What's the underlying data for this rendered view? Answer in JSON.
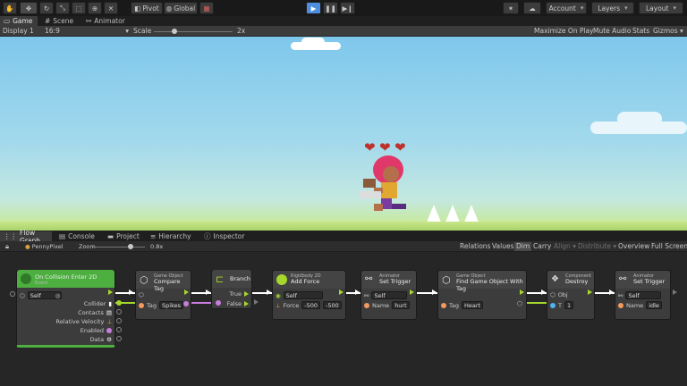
{
  "toolbar": {
    "pivot": "Pivot",
    "global": "Global",
    "account": "Account",
    "layers": "Layers",
    "layout": "Layout"
  },
  "tabs": [
    {
      "label": "Game"
    },
    {
      "label": "Scene"
    },
    {
      "label": "Animator"
    }
  ],
  "gamebar": {
    "display": "Display 1",
    "aspect": "16:9",
    "scale_label": "Scale",
    "scale_value": "2x",
    "maximize": "Maximize On Play",
    "mute": "Mute Audio",
    "stats": "Stats",
    "gizmos": "Gizmos"
  },
  "scene": {
    "hearts": [
      "❤",
      "❤",
      "❤"
    ]
  },
  "bottom_tabs": [
    {
      "label": "Flow Graph"
    },
    {
      "label": "Console"
    },
    {
      "label": "Project"
    },
    {
      "label": "Hierarchy"
    },
    {
      "label": "Inspector"
    }
  ],
  "graph_toolbar": {
    "object": "PennyPixel",
    "zoom_label": "Zoom",
    "zoom_value": "0.8x",
    "relations": "Relations",
    "values": "Values",
    "dim": "Dim",
    "carry": "Carry",
    "align": "Align",
    "distribute": "Distribute",
    "overview": "Overview",
    "fullscreen": "Full Screen"
  },
  "nodes": {
    "event": {
      "title": "On Collision Enter 2D",
      "category": "Event",
      "self": "Self",
      "outputs": [
        "Collider",
        "Contacts",
        "Relative Velocity",
        "Enabled",
        "Data"
      ]
    },
    "compare": {
      "category": "Game Object",
      "title": "Compare Tag",
      "tag_label": "Tag",
      "tag_value": "Spikes"
    },
    "branch": {
      "title": "Branch",
      "true_label": "True",
      "false_label": "False"
    },
    "addforce": {
      "category": "Rigidbody 2D",
      "title": "Add Force",
      "self": "Self",
      "force_label": "Force",
      "fx": "-500",
      "fy": "-500"
    },
    "trigger1": {
      "category": "Animator",
      "title": "Set Trigger",
      "self": "Self",
      "name_label": "Name",
      "name_value": "hurt"
    },
    "find": {
      "category": "Game Object",
      "title": "Find Game Object With Tag",
      "tag_label": "Tag",
      "tag_value": "Heart"
    },
    "destroy": {
      "category": "Component",
      "title": "Destroy",
      "obj_label": "Obj",
      "t_label": "T",
      "t_value": "1"
    },
    "trigger2": {
      "category": "Animator",
      "title": "Set Trigger",
      "self": "Self",
      "name_label": "Name",
      "name_value": "idle"
    }
  },
  "colors": {
    "accent": "#4d8ee0",
    "flow_green": "#a6d72c",
    "event_green": "#4caf3f",
    "port_purple": "#c77ddc",
    "port_orange": "#f59a5c",
    "port_blue": "#4fb2f2"
  }
}
